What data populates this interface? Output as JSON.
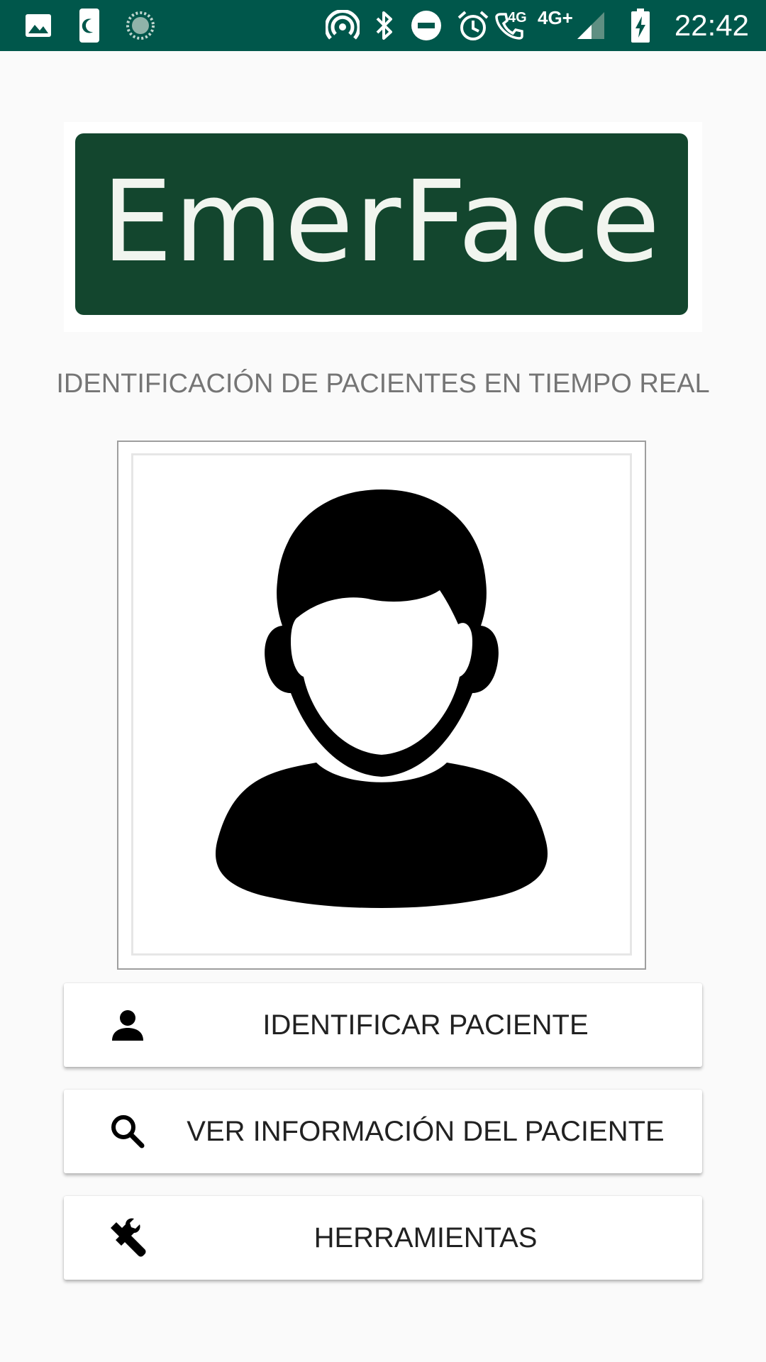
{
  "status_bar": {
    "time": "22:42",
    "network_small": "4G",
    "network_large": "4G+",
    "icons": [
      "gallery-icon",
      "sleep-icon",
      "loading-icon",
      "hotspot-icon",
      "bluetooth-icon",
      "do-not-disturb-icon",
      "alarm-icon",
      "call-icon",
      "signal-icon",
      "battery-charging-icon"
    ],
    "background_color": "#00574b"
  },
  "logo": {
    "text": "EmerFace",
    "background_color": "#13462e",
    "text_color": "#f1f5ef"
  },
  "subtitle": "IDENTIFICACIÓN DE PACIENTES EN TIEMPO REAL",
  "photo": {
    "icon": "user-silhouette-icon"
  },
  "buttons": [
    {
      "label": "IDENTIFICAR PACIENTE",
      "icon": "person-icon"
    },
    {
      "label": "VER INFORMACIÓN DEL PACIENTE",
      "icon": "search-icon"
    },
    {
      "label": "HERRAMIENTAS",
      "icon": "wrench-icon"
    }
  ]
}
